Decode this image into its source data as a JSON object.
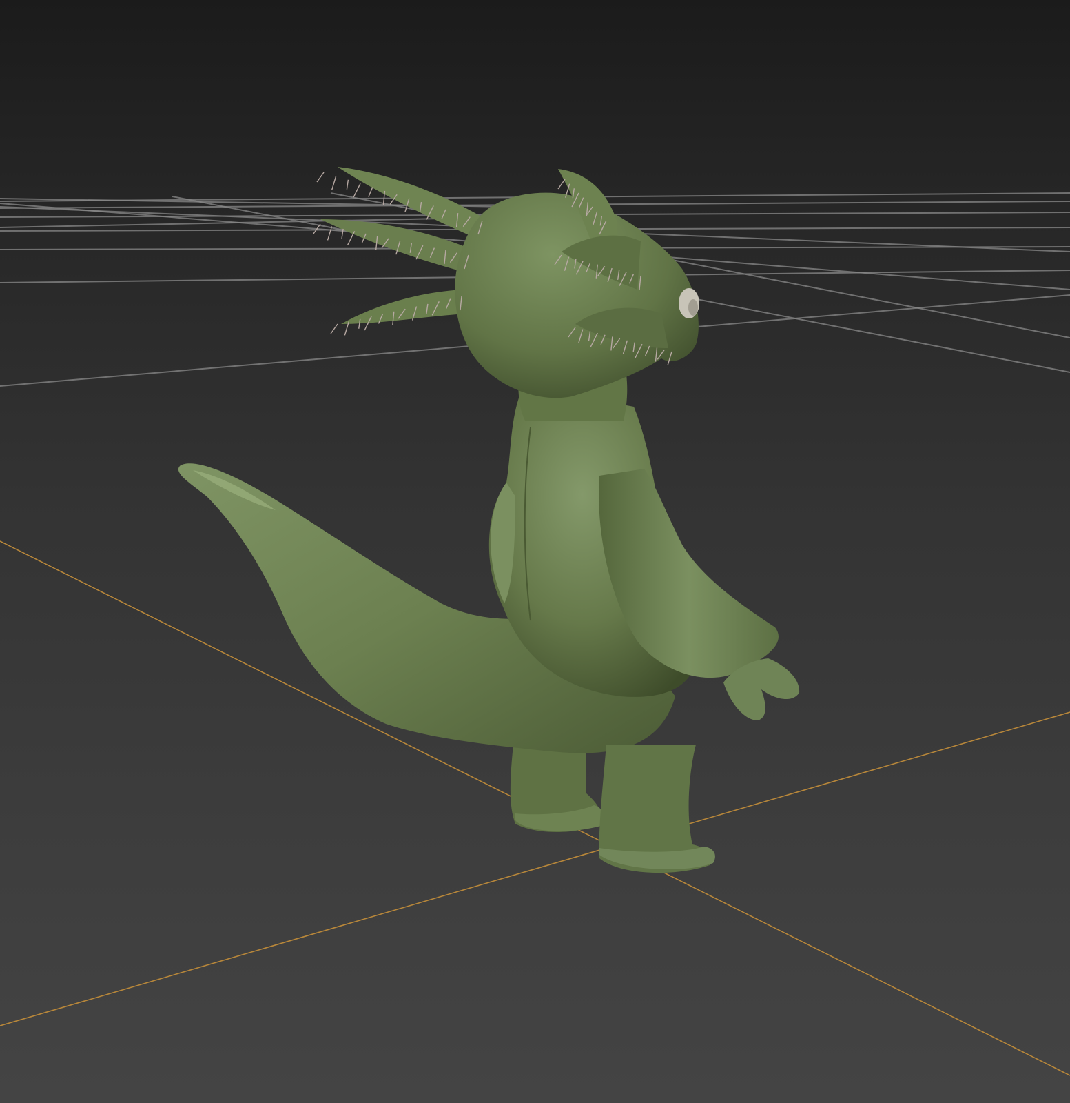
{
  "viewport": {
    "shading_mode": "smooth-shaded",
    "background_top": "#1b1b1b",
    "background_bottom": "#444444"
  },
  "grid": {
    "line_color": "#8a8a8a",
    "world_axis_color": "#b8873a",
    "visible": true
  },
  "model": {
    "kind": "creature-character",
    "body_color": "#66794a",
    "body_highlight": "#8a9e6c",
    "body_shadow": "#3e4c2a",
    "eye_color": "#c8c4b8",
    "hair_fringe_color": "#b6a8a2"
  }
}
